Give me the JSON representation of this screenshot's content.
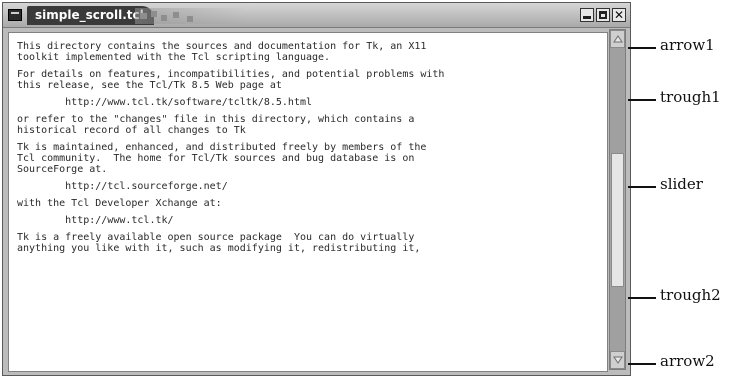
{
  "window": {
    "title": "simple_scroll.tcl",
    "buttons": {
      "minimize_icon": "minimize-icon",
      "maximize_icon": "maximize-icon",
      "close_glyph": "✕"
    }
  },
  "text": {
    "lines": [
      "This directory contains the sources and documentation for Tk, an X11",
      "toolkit implemented with the Tcl scripting language.",
      "",
      "For details on features, incompatibilities, and potential problems with",
      "this release, see the Tcl/Tk 8.5 Web page at",
      "",
      "        http://www.tcl.tk/software/tcltk/8.5.html",
      "",
      "or refer to the \"changes\" file in this directory, which contains a",
      "historical record of all changes to Tk",
      "",
      "Tk is maintained, enhanced, and distributed freely by members of the",
      "Tcl community.  The home for Tcl/Tk sources and bug database is on",
      "SourceForge at.",
      "",
      "        http://tcl.sourceforge.net/",
      "",
      "with the Tcl Developer Xchange at:",
      "",
      "        http://www.tcl.tk/",
      "",
      "Tk is a freely available open source package  You can do virtually",
      "anything you like with it, such as modifying it, redistributing it,"
    ]
  },
  "annotations": {
    "arrow1": "arrow1",
    "trough1": "trough1",
    "slider": "slider",
    "trough2": "trough2",
    "arrow2": "arrow2"
  },
  "colors": {
    "window_frame": "#bcbcbc",
    "title_tab": "#3a3a3a",
    "text_background": "#ffffff",
    "trough": "#a0a0a0",
    "slider": "#e6e6e6"
  }
}
